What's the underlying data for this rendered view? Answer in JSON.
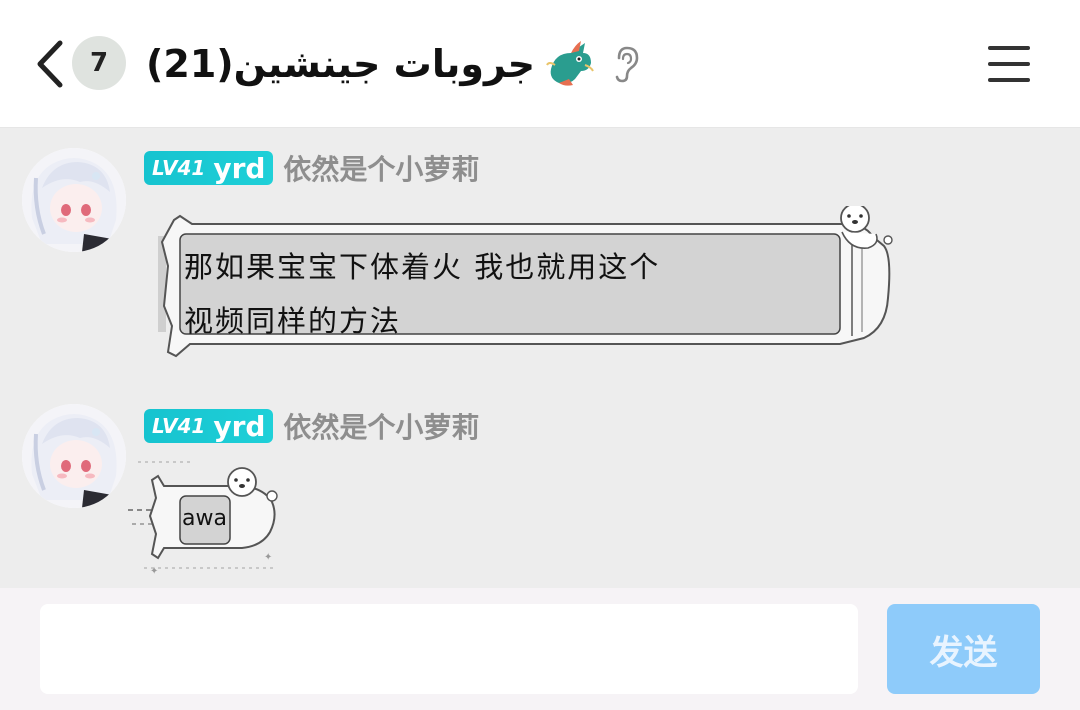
{
  "header": {
    "unread_count": "7",
    "title": "جروبات جينشين(21)",
    "icons": {
      "back": "chevron-left-icon",
      "dragon": "dragon-emoji-icon",
      "ear": "ear-icon",
      "menu": "hamburger-menu-icon"
    }
  },
  "messages": [
    {
      "level": "LV41",
      "level_name": "yrd",
      "sender": "依然是个小萝莉",
      "text_line1": "那如果宝宝下体着火 我也就用这个",
      "text_line2": "视频同样的方法"
    },
    {
      "level": "LV41",
      "level_name": "yrd",
      "sender": "依然是个小萝莉",
      "text": "awa"
    }
  ],
  "composer": {
    "input_value": "",
    "input_placeholder": "",
    "send_label": "发送"
  },
  "colors": {
    "level_badge": "#16c3cf",
    "send_button": "#8ecbfa",
    "chat_background": "#ededed"
  }
}
